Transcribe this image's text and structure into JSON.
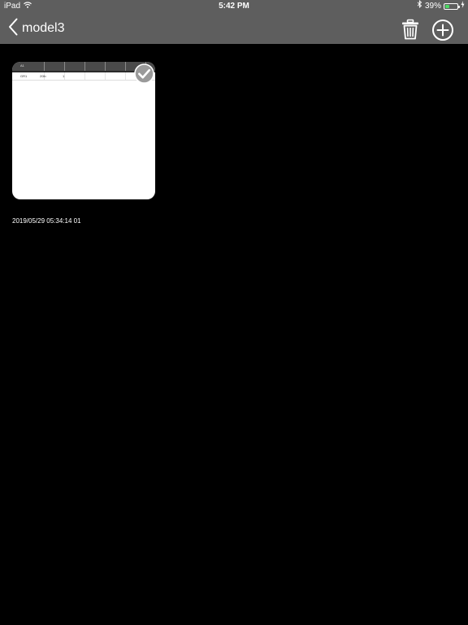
{
  "status_bar": {
    "device": "iPad",
    "time": "5:42 PM",
    "battery_percent_text": "39%",
    "battery_level": 0.39,
    "battery_color": "#4cd964",
    "icons": [
      "wifi-icon",
      "bluetooth-icon",
      "battery-icon",
      "charging-bolt-icon"
    ]
  },
  "nav": {
    "back_icon": "chevron-left-icon",
    "title": "model3",
    "trash_icon": "trash-icon",
    "add_icon": "plus-circle-icon",
    "bar_color": "#5e5e5e"
  },
  "content": {
    "items": [
      {
        "preview": {
          "header_text": "A1",
          "row": [
            "GR1",
            "20lb",
            "1"
          ]
        },
        "selected": true,
        "check_icon": "checkmark-circle-icon",
        "timestamp": "2019/05/29 05:34:14 01"
      }
    ]
  }
}
